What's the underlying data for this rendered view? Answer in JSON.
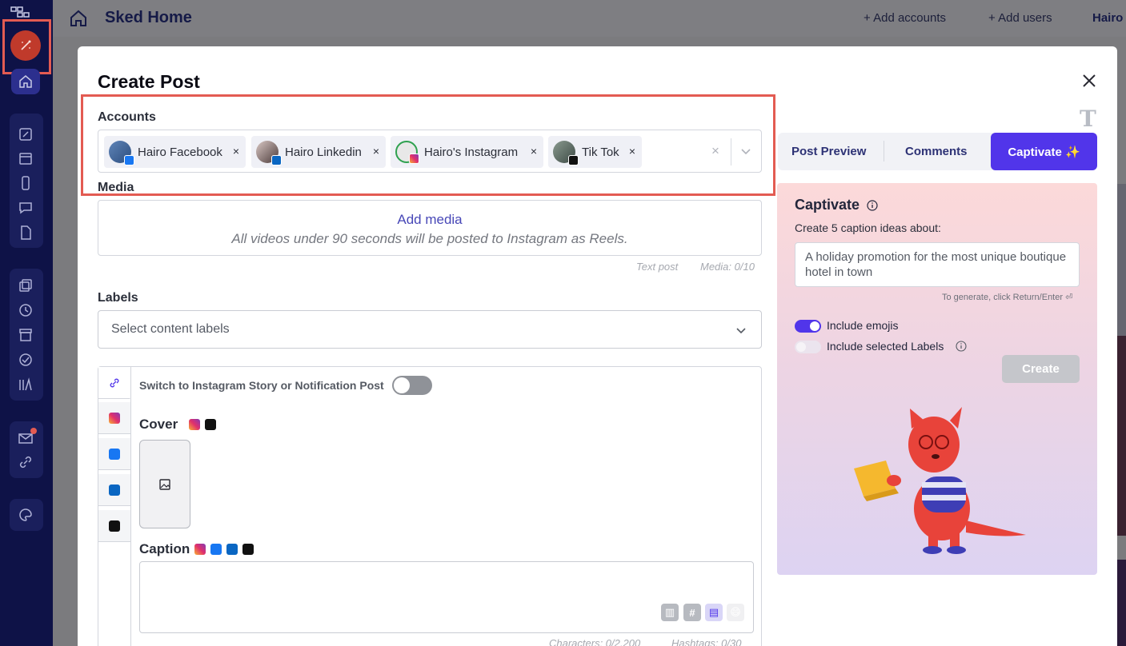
{
  "topbar": {
    "title": "Sked Home",
    "add_accounts": "+ Add accounts",
    "add_users": "+ Add users",
    "user": "Hairo"
  },
  "modal": {
    "title": "Create Post",
    "accounts_label": "Accounts",
    "accounts": [
      {
        "label": "Hairo Facebook",
        "network": "facebook"
      },
      {
        "label": "Hairo Linkedin",
        "network": "linkedin"
      },
      {
        "label": "Hairo's Instagram",
        "network": "instagram"
      },
      {
        "label": "Tik Tok",
        "network": "tiktok"
      }
    ],
    "chip_remove": "×",
    "clear_all": "×",
    "media_label": "Media",
    "add_media": "Add media",
    "media_note": "All videos under 90 seconds will be posted to Instagram as Reels.",
    "post_type": "Text post",
    "media_count": "Media: 0/10",
    "labels_label": "Labels",
    "labels_placeholder": "Select content labels",
    "switch_label": "Switch to Instagram Story or Notification Post",
    "cover_label": "Cover",
    "caption_label": "Caption",
    "characters": "Characters: 0/2,200",
    "hashtags": "Hashtags: 0/30"
  },
  "right": {
    "tab_preview": "Post Preview",
    "tab_comments": "Comments",
    "tab_captivate": "Captivate ✨",
    "captivate_title": "Captivate",
    "captivate_sub": "Create 5 caption ideas about:",
    "captivate_prompt": "A holiday promotion for the most unique boutique hotel in town",
    "captivate_hint": "To generate, click Return/Enter ⏎",
    "include_emojis": "Include emojis",
    "include_labels": "Include selected Labels",
    "create_button": "Create"
  },
  "colors": {
    "sidebar": "#0e1247",
    "accent": "#5135ea",
    "highlight": "#e35b52"
  }
}
